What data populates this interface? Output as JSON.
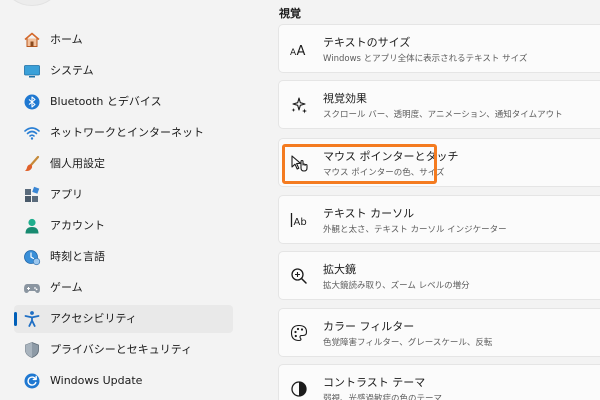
{
  "sidebar": {
    "items": [
      {
        "label": "ホーム",
        "icon": "home-icon",
        "active": false
      },
      {
        "label": "システム",
        "icon": "system-icon",
        "active": false
      },
      {
        "label": "Bluetooth とデバイス",
        "icon": "bluetooth-icon",
        "active": false
      },
      {
        "label": "ネットワークとインターネット",
        "icon": "wifi-icon",
        "active": false
      },
      {
        "label": "個人用設定",
        "icon": "brush-icon",
        "active": false
      },
      {
        "label": "アプリ",
        "icon": "apps-icon",
        "active": false
      },
      {
        "label": "アカウント",
        "icon": "account-icon",
        "active": false
      },
      {
        "label": "時刻と言語",
        "icon": "time-language-icon",
        "active": false
      },
      {
        "label": "ゲーム",
        "icon": "gamepad-icon",
        "active": false
      },
      {
        "label": "アクセシビリティ",
        "icon": "accessibility-icon",
        "active": true
      },
      {
        "label": "プライバシーとセキュリティ",
        "icon": "shield-icon",
        "active": false
      },
      {
        "label": "Windows Update",
        "icon": "windows-update-icon",
        "active": false
      }
    ]
  },
  "main": {
    "section_title": "視覚",
    "cards": [
      {
        "title": "テキストのサイズ",
        "subtitle": "Windows とアプリ全体に表示されるテキスト サイズ",
        "icon": "text-size-icon"
      },
      {
        "title": "視覚効果",
        "subtitle": "スクロール バー、透明度、アニメーション、通知タイムアウト",
        "icon": "visual-effects-icon"
      },
      {
        "title": "マウス ポインターとタッチ",
        "subtitle": "マウス ポインターの色、サイズ",
        "icon": "mouse-pointer-touch-icon",
        "focused": true
      },
      {
        "title": "テキスト カーソル",
        "subtitle": "外観と太さ、テキスト カーソル インジケーター",
        "icon": "text-cursor-icon"
      },
      {
        "title": "拡大鏡",
        "subtitle": "拡大鏡読み取り、ズーム レベルの増分",
        "icon": "magnifier-icon"
      },
      {
        "title": "カラー フィルター",
        "subtitle": "色覚障害フィルター、グレースケール、反転",
        "icon": "color-filter-icon"
      },
      {
        "title": "コントラスト テーマ",
        "subtitle": "弱視、光感過敏症の色のテーマ",
        "icon": "contrast-theme-icon"
      }
    ]
  },
  "colors": {
    "accent": "#005fb8",
    "focus_ring": "#f47b20",
    "background": "#f3f3f3",
    "card": "#fbfbfb"
  }
}
